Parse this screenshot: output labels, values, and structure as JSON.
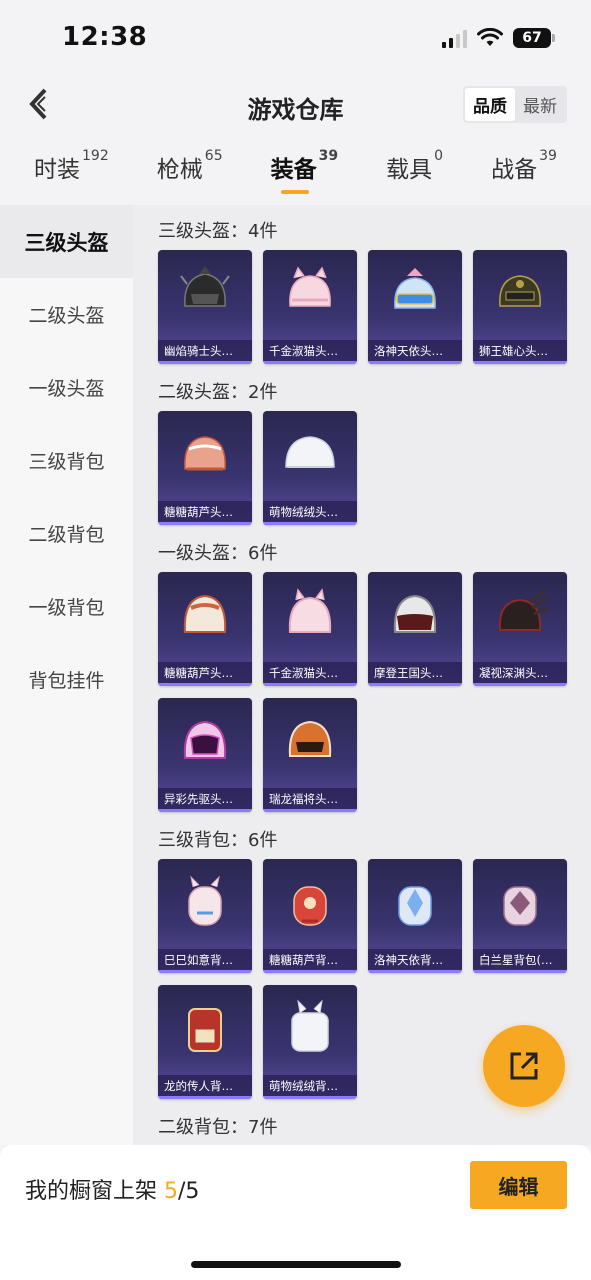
{
  "status_bar": {
    "time": "12:38",
    "battery": "67"
  },
  "header": {
    "title": "游戏仓库",
    "sort_options": [
      "品质",
      "最新"
    ]
  },
  "tabs": [
    {
      "label": "时装",
      "count": "192"
    },
    {
      "label": "枪械",
      "count": "65"
    },
    {
      "label": "装备",
      "count": "39"
    },
    {
      "label": "载具",
      "count": "0"
    },
    {
      "label": "战备",
      "count": "39"
    }
  ],
  "sidebar": {
    "items": [
      "三级头盔",
      "二级头盔",
      "一级头盔",
      "三级背包",
      "二级背包",
      "一级背包",
      "背包挂件"
    ]
  },
  "sections": [
    {
      "title": "三级头盔：4件",
      "items": [
        {
          "name": "幽焰骑士头…",
          "icon": "helmet-icon"
        },
        {
          "name": "千金淑猫头…",
          "icon": "helmet-icon"
        },
        {
          "name": "洛神天依头…",
          "icon": "helmet-icon"
        },
        {
          "name": "狮王雄心头…",
          "icon": "helmet-icon"
        }
      ]
    },
    {
      "title": "二级头盔：2件",
      "items": [
        {
          "name": "糖糖葫芦头…",
          "icon": "helmet-icon"
        },
        {
          "name": "萌物绒绒头…",
          "icon": "helmet-icon"
        }
      ]
    },
    {
      "title": "一级头盔：6件",
      "items": [
        {
          "name": "糖糖葫芦头…",
          "icon": "helmet-icon"
        },
        {
          "name": "千金淑猫头…",
          "icon": "helmet-icon"
        },
        {
          "name": "摩登王国头…",
          "icon": "helmet-icon"
        },
        {
          "name": "凝视深渊头…",
          "icon": "helmet-icon"
        },
        {
          "name": "异彩先驱头…",
          "icon": "helmet-icon"
        },
        {
          "name": "瑞龙福将头…",
          "icon": "helmet-icon"
        }
      ]
    },
    {
      "title": "三级背包：6件",
      "items": [
        {
          "name": "巳巳如意背…",
          "icon": "backpack-icon"
        },
        {
          "name": "糖糖葫芦背…",
          "icon": "backpack-icon"
        },
        {
          "name": "洛神天依背…",
          "icon": "backpack-icon"
        },
        {
          "name": "白兰星背包(…",
          "icon": "backpack-icon"
        },
        {
          "name": "龙的传人背…",
          "icon": "backpack-icon"
        },
        {
          "name": "萌物绒绒背…",
          "icon": "backpack-icon"
        }
      ]
    },
    {
      "title": "二级背包：7件",
      "items": []
    }
  ],
  "bottom_bar": {
    "label": "我的橱窗上架",
    "current": "5",
    "total": "/5",
    "edit_label": "编辑"
  },
  "colors": {
    "accent": "#f7a823",
    "card_bg": "#3a3470",
    "card_line": "#8c7bff"
  }
}
